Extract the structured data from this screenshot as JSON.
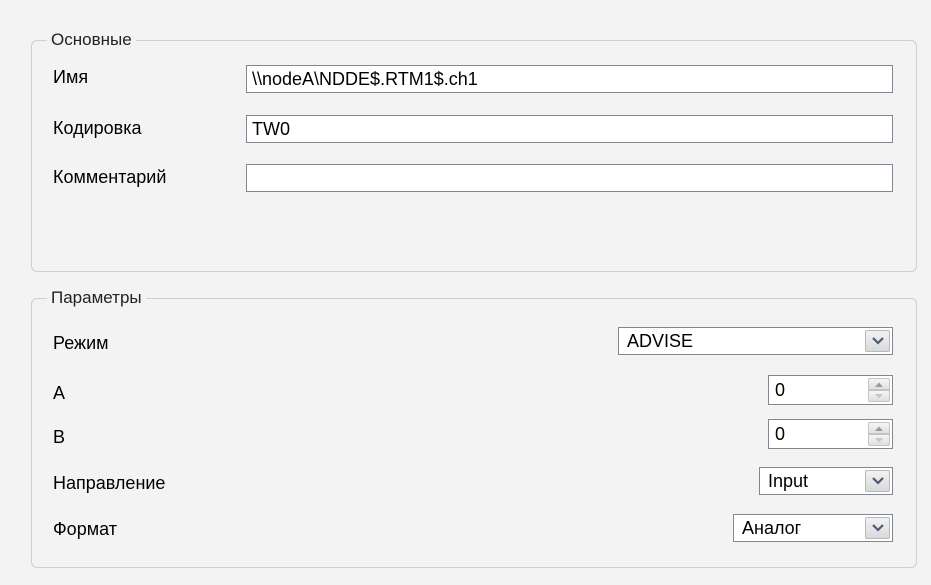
{
  "basic": {
    "legend": "Основные",
    "name_label": "Имя",
    "name_value": "\\\\nodeA\\NDDE$.RTM1$.ch1",
    "encoding_label": "Кодировка",
    "encoding_value": "TW0",
    "comment_label": "Комментарий",
    "comment_value": ""
  },
  "params": {
    "legend": "Параметры",
    "mode_label": "Режим",
    "mode_value": "ADVISE",
    "a_label": "A",
    "a_value": "0",
    "b_label": "B",
    "b_value": "0",
    "direction_label": "Направление",
    "direction_value": "Input",
    "format_label": "Формат",
    "format_value": "Аналог"
  },
  "icons": {
    "dropdown": "chevron-down-icon",
    "spin_up": "arrow-up-icon",
    "spin_down": "arrow-down-icon"
  },
  "colors": {
    "background": "#f3f3f3",
    "field_border": "#828790",
    "group_border": "#cfcfcf"
  }
}
